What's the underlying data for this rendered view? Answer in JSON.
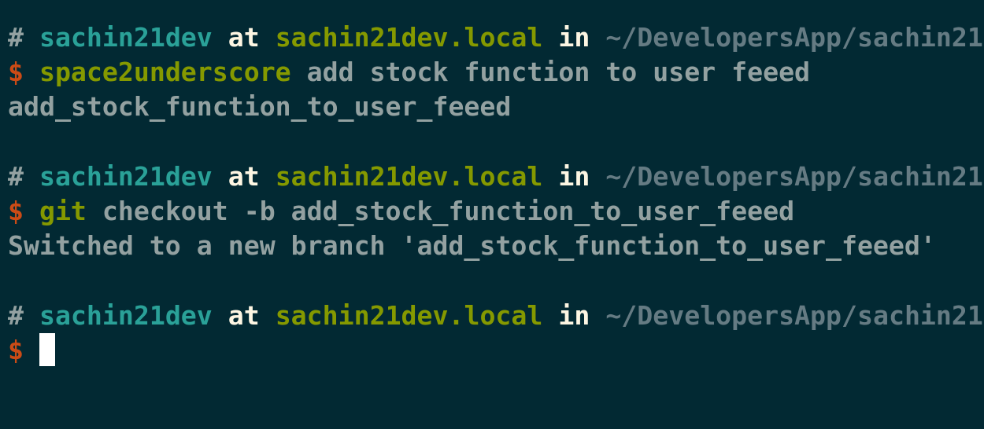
{
  "colors": {
    "background": "#022933",
    "user": "#2aa198",
    "host": "#859900",
    "at": "#fdf6e3",
    "path": "#657b83",
    "dollar": "#cb4b16",
    "text": "#93a1a1",
    "cursor": "#ffffff"
  },
  "prompt": {
    "hash": "#",
    "user": "sachin21dev",
    "at": "at",
    "host": "sachin21dev.local",
    "in": "in",
    "path": "~/DevelopersApp/sachin21",
    "dollar": "$"
  },
  "blocks": [
    {
      "command": "space2underscore",
      "args": "add stock function to user feeed",
      "output": "add_stock_function_to_user_feeed"
    },
    {
      "command": "git",
      "args": "checkout -b add_stock_function_to_user_feeed",
      "output": "Switched to a new branch 'add_stock_function_to_user_feeed'"
    }
  ]
}
